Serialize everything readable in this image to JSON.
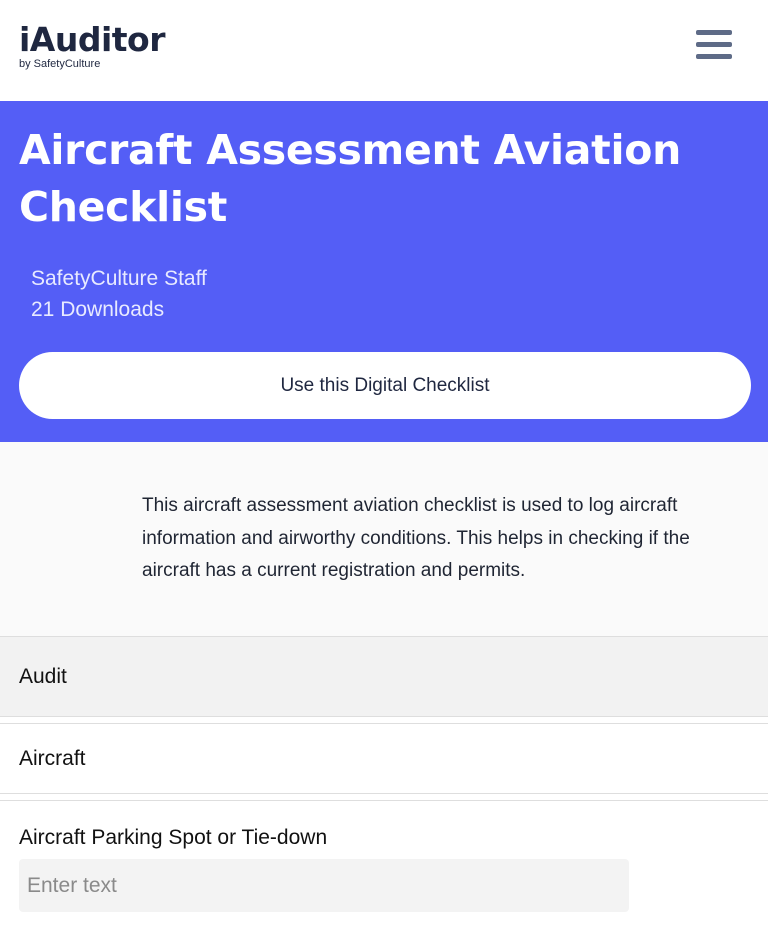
{
  "header": {
    "logo_main": "iAuditor",
    "logo_sub": "by SafetyCulture",
    "menu_icon": "hamburger-menu-icon"
  },
  "hero": {
    "title": "Aircraft Assessment Aviation Checklist",
    "author": "SafetyCulture Staff",
    "downloads": "21 Downloads",
    "cta_label": "Use this Digital Checklist",
    "background_color": "#545ef6"
  },
  "description": "This aircraft assessment aviation checklist is used to log aircraft information and airworthy conditions. This helps in checking if the aircraft has a current registration and permits.",
  "sections": {
    "audit_label": "Audit",
    "aircraft_label": "Aircraft"
  },
  "field": {
    "label": "Aircraft Parking Spot or Tie-down",
    "placeholder": "Enter text",
    "value": ""
  }
}
